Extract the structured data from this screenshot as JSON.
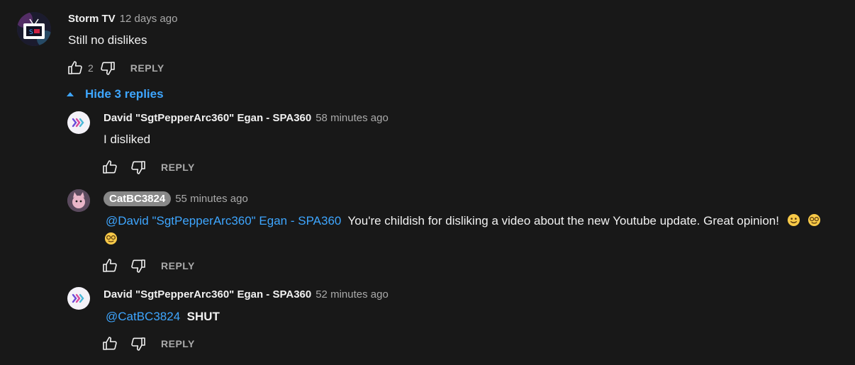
{
  "main_comment": {
    "author": "Storm TV",
    "time": "12 days ago",
    "text": "Still no dislikes",
    "like_count": "2",
    "reply_label": "REPLY"
  },
  "replies_toggle": {
    "label": "Hide 3 replies"
  },
  "replies": [
    {
      "author": "David \"SgtPepperArc360\" Egan - SPA360",
      "time": "58 minutes ago",
      "text": "I disliked",
      "reply_label": "REPLY"
    },
    {
      "author": "CatBC3824",
      "time": "55 minutes ago",
      "mention": "@David \"SgtPepperArc360\" Egan - SPA360",
      "text": "You're childish for disliking a video about the new Youtube update. Great opinion!",
      "reply_label": "REPLY"
    },
    {
      "author": "David \"SgtPepperArc360\" Egan - SPA360",
      "time": "52 minutes ago",
      "mention": "@CatBC3824",
      "text": "SHUT",
      "reply_label": "REPLY"
    }
  ],
  "colors": {
    "background": "#181818",
    "link": "#3ea6ff",
    "secondary_text": "#aaaaaa"
  },
  "icons": [
    "thumb-up-icon",
    "thumb-down-icon",
    "caret-up-icon",
    "smiley-emoji",
    "nerd-emoji"
  ]
}
